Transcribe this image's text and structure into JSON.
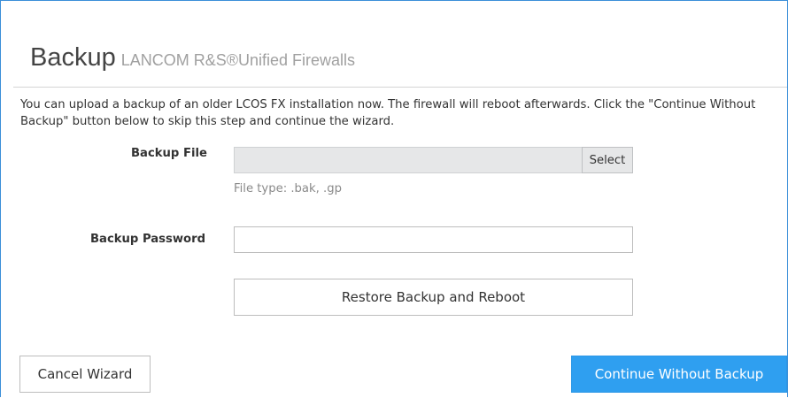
{
  "header": {
    "title": "Backup",
    "subtitle": "LANCOM R&S®Unified Firewalls"
  },
  "intro_text": "You can upload a backup of an older LCOS FX installation now. The firewall will reboot afterwards. Click the \"Continue Without Backup\" button below to skip this step and continue the wizard.",
  "backup_file": {
    "label": "Backup File",
    "value": "",
    "select_label": "Select",
    "hint": "File type: .bak, .gp"
  },
  "backup_password": {
    "label": "Backup Password",
    "value": "",
    "placeholder": ""
  },
  "restore_button": "Restore Backup and Reboot",
  "footer": {
    "cancel_label": "Cancel Wizard",
    "continue_label": "Continue Without Backup"
  },
  "colors": {
    "accent": "#2f9ff0",
    "frame_border": "#3b8fd9",
    "file_field_bg": "#e6e7e8"
  }
}
